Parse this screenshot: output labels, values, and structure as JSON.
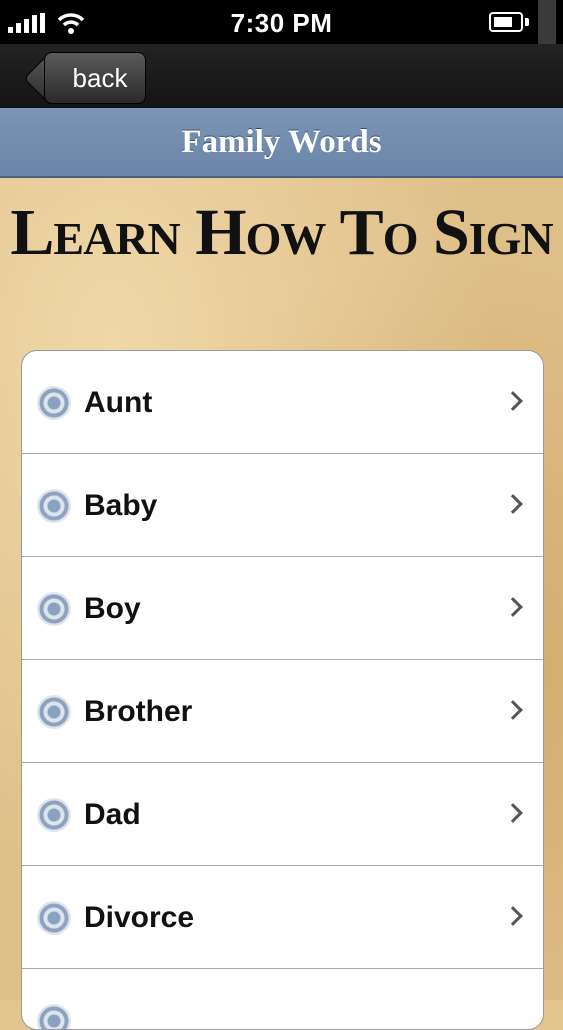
{
  "status_bar": {
    "time": "7:30 PM",
    "icons": [
      "signal-icon",
      "wifi-icon",
      "battery-icon"
    ]
  },
  "nav": {
    "back_label": "back"
  },
  "title_bar": {
    "title": "Family Words"
  },
  "headline": "Learn How To Sign",
  "list": {
    "items": [
      {
        "label": "Aunt"
      },
      {
        "label": "Baby"
      },
      {
        "label": "Boy"
      },
      {
        "label": "Brother"
      },
      {
        "label": "Dad"
      },
      {
        "label": "Divorce"
      }
    ]
  },
  "colors": {
    "title_bar": "#7188ab",
    "parchment": "#dfbf88",
    "nav_bar": "#1c1c1c"
  }
}
